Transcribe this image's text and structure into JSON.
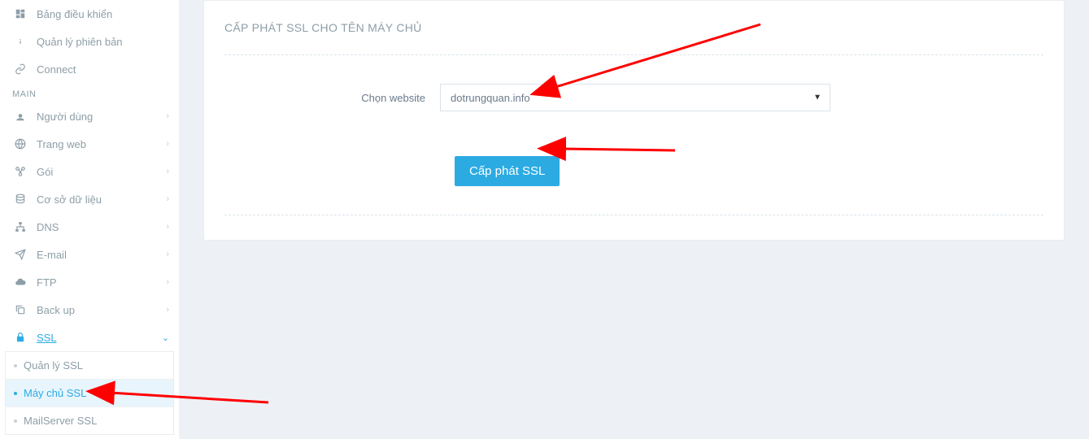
{
  "sidebar": {
    "top_items": [
      {
        "label": "Bảng điều khiển",
        "icon": "dashboard"
      },
      {
        "label": "Quản lý phiên bản",
        "icon": "info"
      },
      {
        "label": "Connect",
        "icon": "link"
      }
    ],
    "section_label": "MAIN",
    "main_items": [
      {
        "label": "Người dùng",
        "icon": "users",
        "expandable": true
      },
      {
        "label": "Trang web",
        "icon": "globe",
        "expandable": true
      },
      {
        "label": "Gói",
        "icon": "package",
        "expandable": true
      },
      {
        "label": "Cơ sở dữ liệu",
        "icon": "database",
        "expandable": true
      },
      {
        "label": "DNS",
        "icon": "sitemap",
        "expandable": true
      },
      {
        "label": "E-mail",
        "icon": "send",
        "expandable": true
      },
      {
        "label": "FTP",
        "icon": "cloud",
        "expandable": true
      },
      {
        "label": "Back up",
        "icon": "copy",
        "expandable": true
      },
      {
        "label": "SSL",
        "icon": "lock",
        "expandable": true,
        "active": true,
        "open": true
      }
    ],
    "ssl_submenu": [
      {
        "label": "Quản lý SSL",
        "active": false
      },
      {
        "label": "Máy chủ SSL",
        "active": true
      },
      {
        "label": "MailServer SSL",
        "active": false
      }
    ]
  },
  "panel": {
    "title": "CẤP PHÁT SSL CHO TÊN MÁY CHỦ",
    "select_label": "Chọn website",
    "select_value": "dotrungquan.info",
    "button_label": "Cấp phát SSL"
  }
}
